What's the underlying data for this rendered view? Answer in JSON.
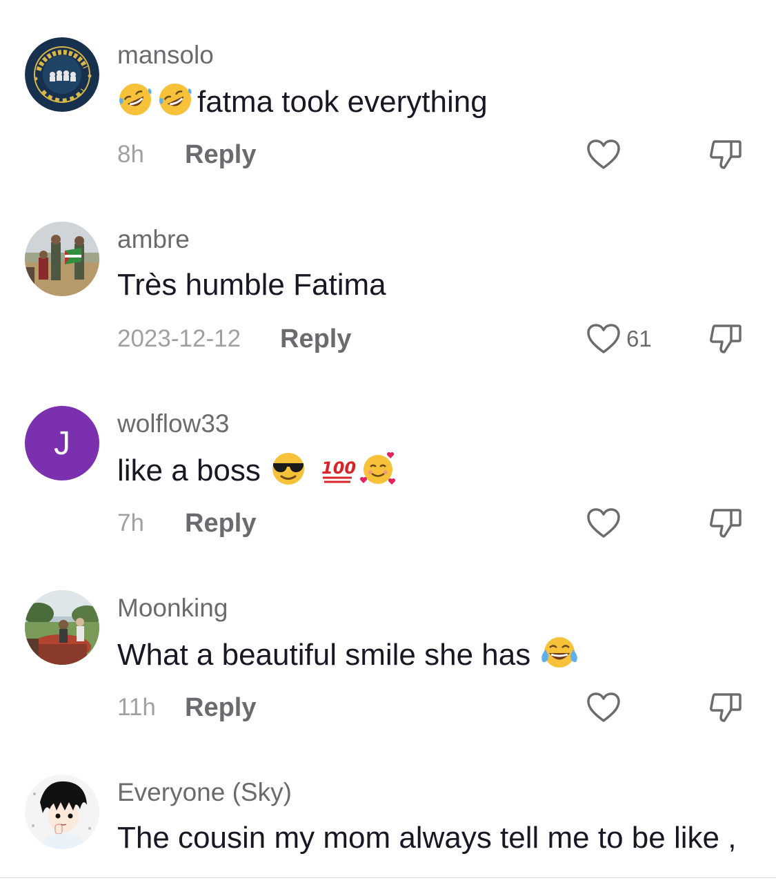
{
  "comments": [
    {
      "username": "mansolo",
      "text": "fatma took everything",
      "emojis_before": [
        "rolling-on-floor-laughing",
        "rolling-on-floor-laughing"
      ],
      "timestamp": "8h",
      "reply_label": "Reply",
      "like_count": "",
      "avatar": {
        "type": "image",
        "badge_text_top": "TEAM NO QABIL",
        "badge_text_bottom": "STAND UP"
      }
    },
    {
      "username": "ambre",
      "text": "Très humble Fatima",
      "timestamp": "2023-12-12",
      "reply_label": "Reply",
      "like_count": "61",
      "avatar": {
        "type": "image"
      }
    },
    {
      "username": "wolflow33",
      "text": "like a boss",
      "emojis_after": [
        "smiling-face-with-sunglasses",
        "hundred-points",
        "smiling-face-with-hearts"
      ],
      "timestamp": "7h",
      "reply_label": "Reply",
      "like_count": "",
      "avatar": {
        "type": "letter",
        "letter": "J",
        "color": "#7b30b0"
      }
    },
    {
      "username": "Moonking",
      "text": "What a beautiful smile she has",
      "emojis_after": [
        "face-with-tears-of-joy"
      ],
      "timestamp": "11h",
      "reply_label": "Reply",
      "like_count": "",
      "avatar": {
        "type": "image"
      }
    },
    {
      "username": "Everyone (Sky)",
      "text": "The cousin my mom always tell me to be like ,",
      "timestamp": "",
      "reply_label": "",
      "like_count": "",
      "avatar": {
        "type": "image"
      }
    }
  ],
  "colors": {
    "username": "#6b6b6f",
    "text": "#161823",
    "timestamp": "#a0a0a4",
    "icon_stroke": "#6b6b6f"
  }
}
